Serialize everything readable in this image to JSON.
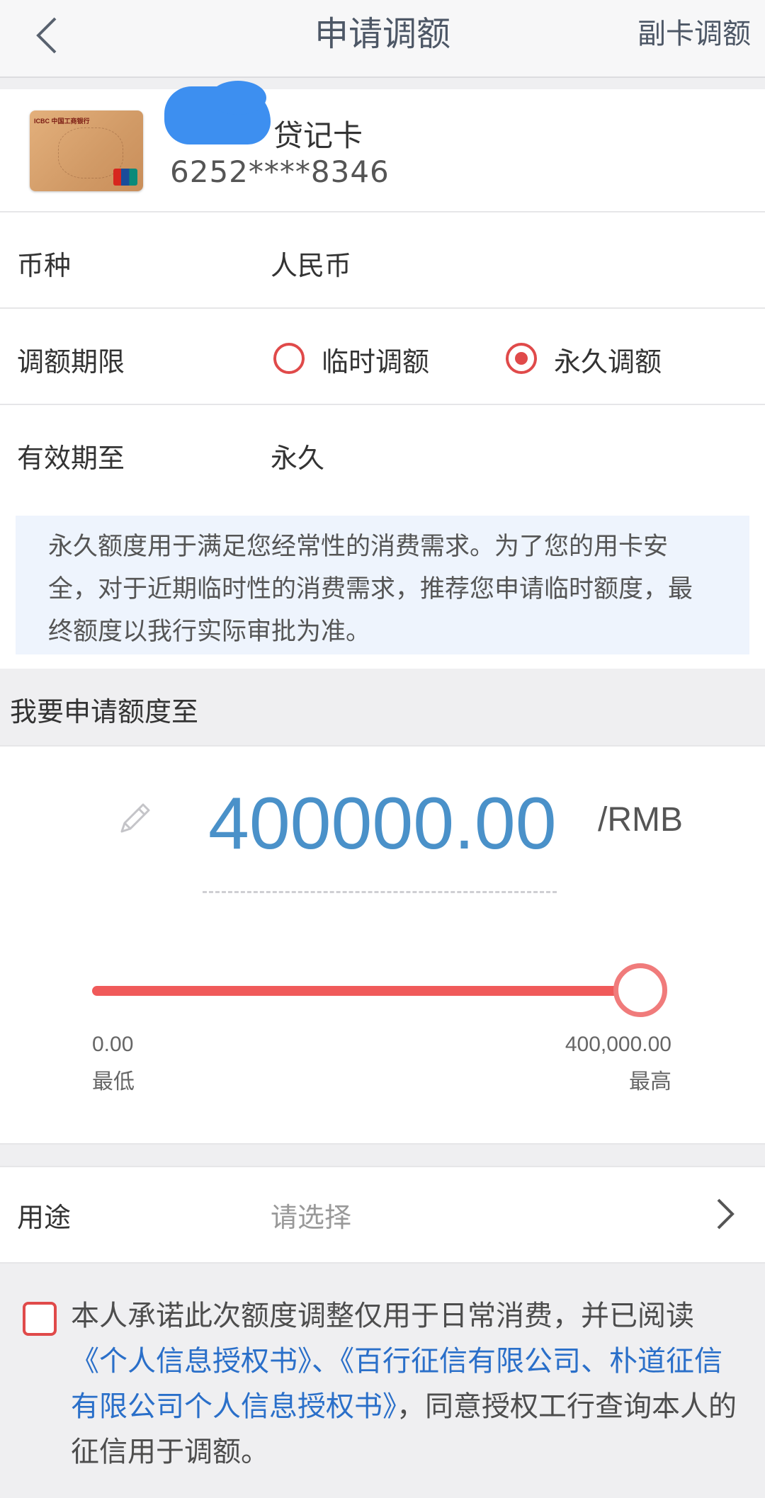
{
  "header": {
    "title": "申请调额",
    "secondary_action": "副卡调额"
  },
  "card": {
    "name_suffix": "贷记卡",
    "number": "6252****8346"
  },
  "form": {
    "currency_label": "币种",
    "currency_value": "人民币",
    "term_label": "调额期限",
    "term_options": [
      "临时调额",
      "永久调额"
    ],
    "term_selected": "永久调额",
    "valid_until_label": "有效期至",
    "valid_until_value": "永久"
  },
  "notice": "永久额度用于满足您经常性的消费需求。为了您的用卡安全，对于近期临时性的消费需求，推荐您申请临时额度，最终额度以我行实际审批为准。",
  "amount_section": {
    "title": "我要申请额度至",
    "amount": "400000.00",
    "unit": "/RMB",
    "min_value": "0.00",
    "min_label": "最低",
    "max_value": "400,000.00",
    "max_label": "最高",
    "slider_fraction": 1.0
  },
  "purpose": {
    "label": "用途",
    "placeholder": "请选择"
  },
  "agreement": {
    "text_before": "本人承诺此次额度调整仅用于日常消费，并已阅读",
    "link1": "《个人信息授权书》",
    "separator": "、",
    "link2": "《百行征信有限公司、朴道征信有限公司个人信息授权书》",
    "text_after": "，同意授权工行查询本人的征信用于调额。"
  },
  "colors": {
    "accent_red": "#e04a4a",
    "amount_blue": "#4a91c9",
    "link_blue": "#2a6fc9"
  }
}
